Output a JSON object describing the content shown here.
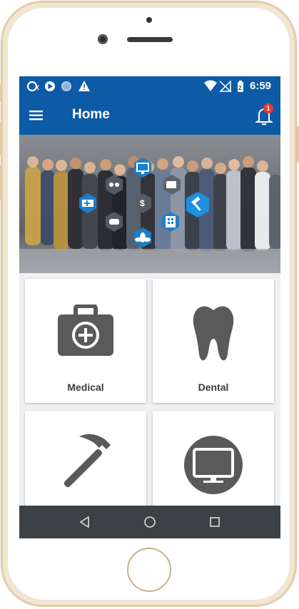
{
  "status_bar": {
    "time": "6:59",
    "left_icons": [
      "data-saver-icon",
      "play-icon",
      "circle-icon",
      "warning-icon"
    ],
    "right_icons": [
      "wifi-icon",
      "no-signal-icon",
      "battery-icon"
    ]
  },
  "app_bar": {
    "title": "Home",
    "notification_count": "1",
    "color": "#0d5aa7"
  },
  "categories": [
    {
      "label": "Medical",
      "icon": "medical-kit-icon"
    },
    {
      "label": "Dental",
      "icon": "tooth-icon"
    },
    {
      "label": "",
      "icon": "hammer-icon"
    },
    {
      "label": "",
      "icon": "monitor-icon"
    }
  ],
  "nav_bar": {
    "buttons": [
      "back-icon",
      "home-icon",
      "recents-icon"
    ]
  }
}
